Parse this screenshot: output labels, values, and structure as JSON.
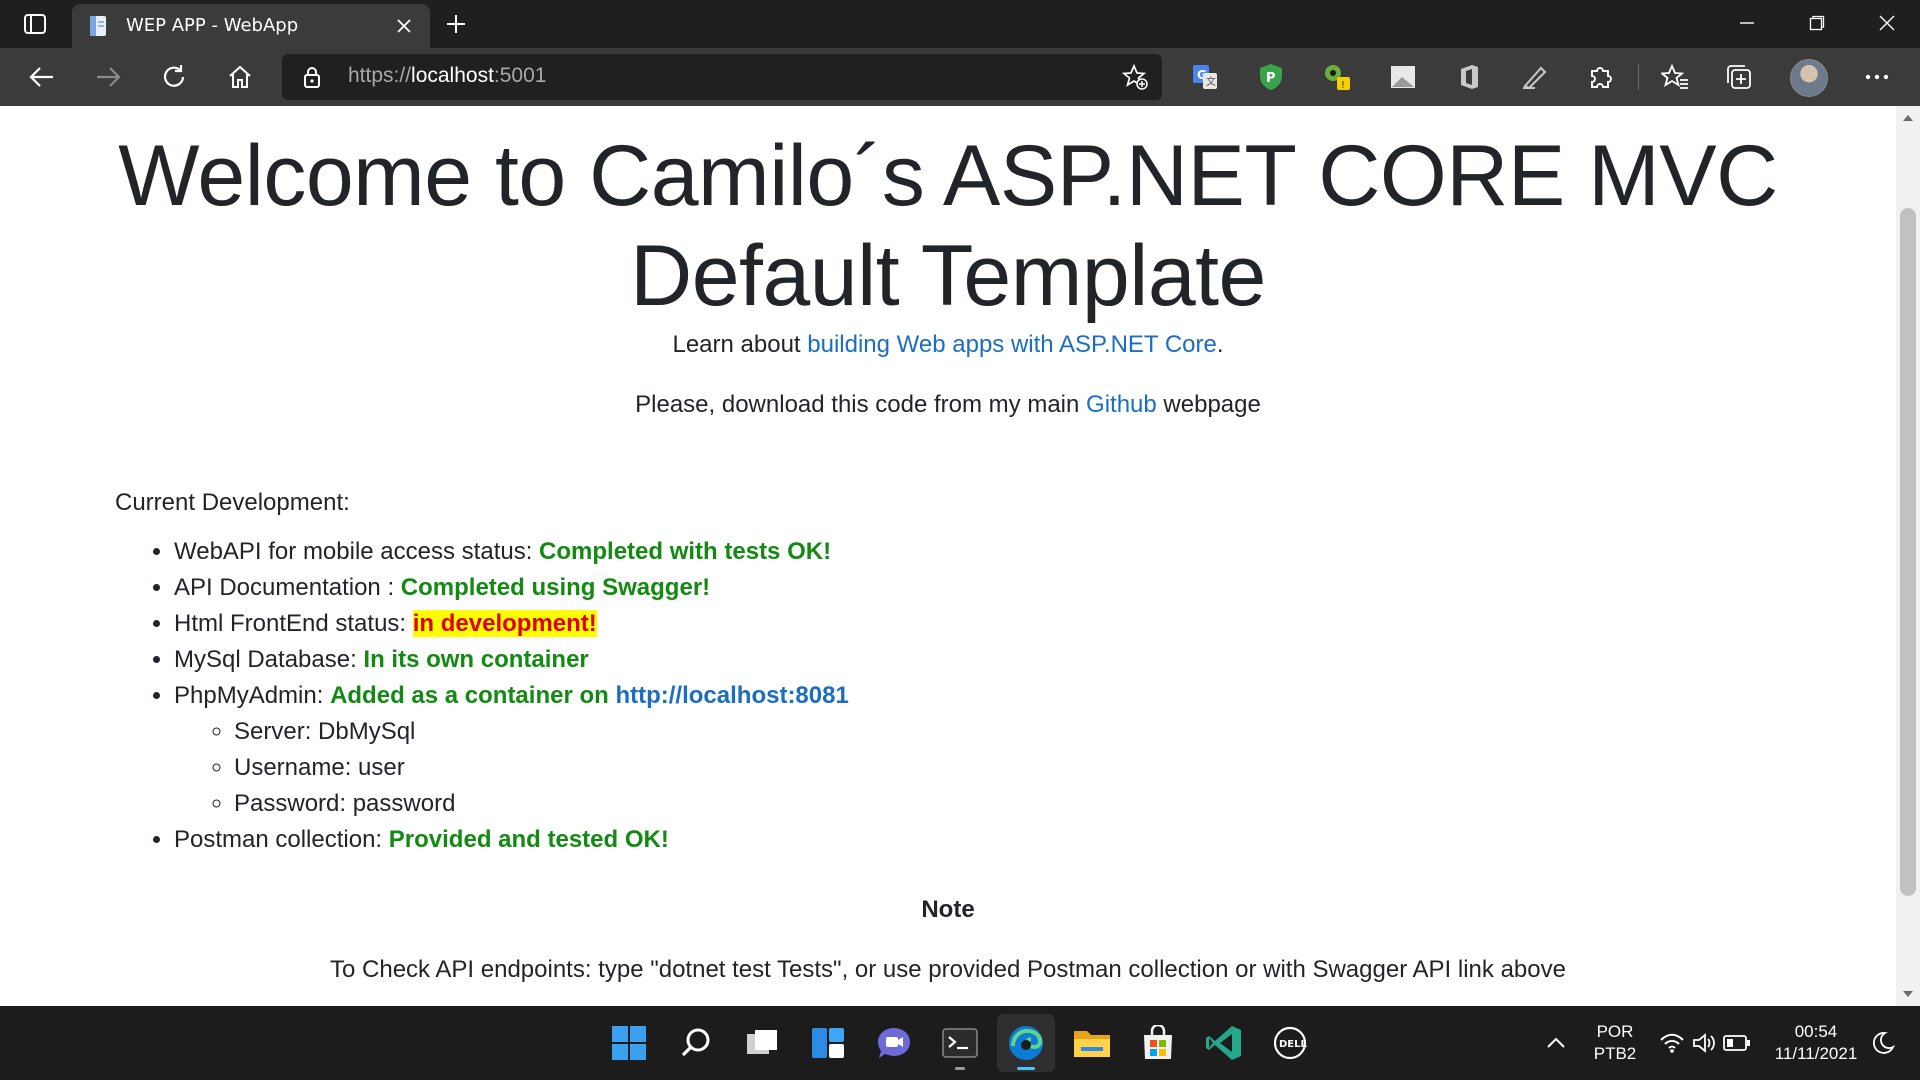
{
  "browser": {
    "tab": {
      "title": "WEP APP - WebApp"
    },
    "address": {
      "scheme": "https://",
      "host": "localhost",
      "port": ":5001"
    }
  },
  "page": {
    "title": "Welcome to Camilo´s ASP.NET CORE MVC Default Template",
    "learn": {
      "prefix": "Learn about ",
      "link": "building Web apps with ASP.NET Core",
      "suffix": "."
    },
    "download": {
      "prefix": "Please, download this code from my main ",
      "link": "Github",
      "suffix": " webpage"
    },
    "current_dev_label": "Current Development:",
    "items": [
      {
        "label": "WebAPI for mobile access status: ",
        "status": "Completed with tests OK!"
      },
      {
        "label": "API Documentation : ",
        "status": "Completed using Swagger!"
      },
      {
        "label": "Html FrontEnd status: ",
        "status": "in development!"
      },
      {
        "label": "MySql Database: ",
        "status": "In its own container"
      },
      {
        "label": "PhpMyAdmin: ",
        "status": "Added as a container on ",
        "link": "http://localhost:8081",
        "sub": [
          "Server: DbMySql",
          "Username: user",
          "Password: password"
        ]
      },
      {
        "label": "Postman collection: ",
        "status": "Provided and tested OK!"
      }
    ],
    "note_title": "Note",
    "note_text": "To Check API endpoints: type \"dotnet test Tests\", or use provided Postman collection or with Swagger API link above"
  },
  "taskbar": {
    "language": "POR",
    "layout": "PTB2",
    "time": "00:54",
    "date": "11/11/2021"
  },
  "colors": {
    "ok": "#138a12",
    "dev_text": "#e00000",
    "dev_highlight": "#ffff00",
    "link": "#1b6ec2"
  }
}
